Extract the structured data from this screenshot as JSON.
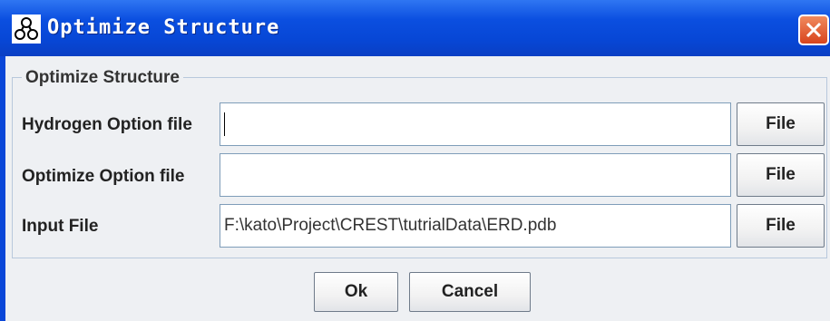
{
  "window": {
    "title": "Optimize Structure",
    "icon": "molecule-icon",
    "close_icon": "close-icon",
    "colors": {
      "titlebar": "#0747d6",
      "close": "#d8441d",
      "client": "#eef0f3"
    }
  },
  "group": {
    "title": "Optimize Structure",
    "rows": [
      {
        "label": "Hydrogen Option file",
        "value": "",
        "focused": true,
        "button": "File"
      },
      {
        "label": "Optimize Option file",
        "value": "",
        "button": "File"
      },
      {
        "label": "Input File",
        "value": "F:\\kato\\Project\\CREST\\tutrialData\\ERD.pdb",
        "button": "File"
      }
    ]
  },
  "actions": {
    "ok": "Ok",
    "cancel": "Cancel"
  }
}
